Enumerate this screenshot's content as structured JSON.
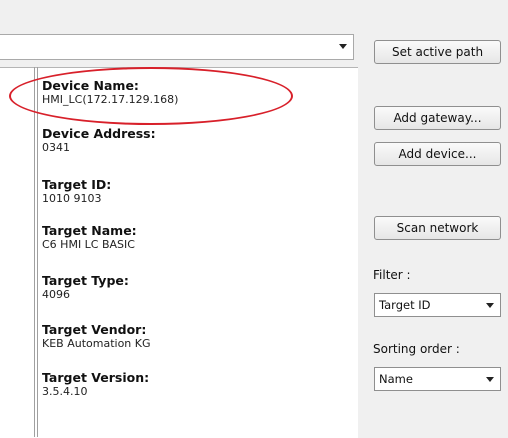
{
  "toolbar": {
    "set_active_path_label": "Set active path"
  },
  "device_details": {
    "fields": [
      {
        "label": "Device Name:",
        "value": "HMI_LC(172.17.129.168)"
      },
      {
        "label": "Device Address:",
        "value": "0341"
      },
      {
        "label": "Target ID:",
        "value": "1010 9103"
      },
      {
        "label": "Target Name:",
        "value": "C6 HMI LC BASIC"
      },
      {
        "label": "Target Type:",
        "value": "4096"
      },
      {
        "label": "Target Vendor:",
        "value": "KEB Automation KG"
      },
      {
        "label": "Target Version:",
        "value": "3.5.4.10"
      }
    ]
  },
  "actions": {
    "add_gateway": "Add gateway...",
    "add_device": "Add device...",
    "scan_network": "Scan network"
  },
  "filter": {
    "label": "Filter :",
    "selected": "Target ID"
  },
  "sorting": {
    "label": "Sorting order :",
    "selected": "Name"
  },
  "annotation": {
    "highlight_color": "#d8202a"
  }
}
